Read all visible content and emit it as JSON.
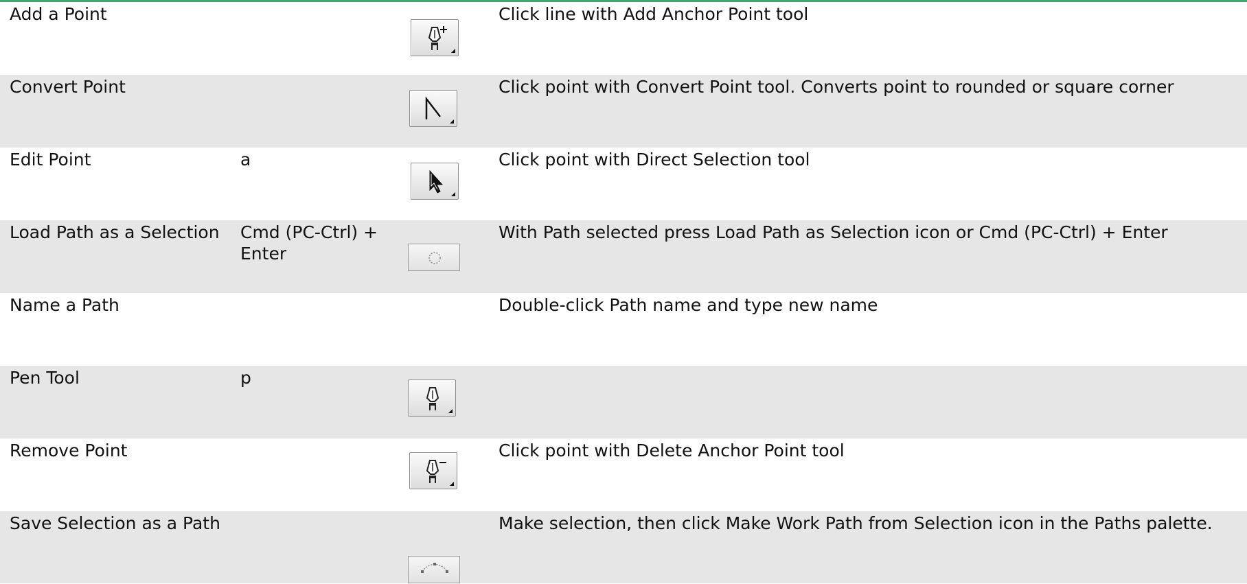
{
  "rows": [
    {
      "task": "Add a Point",
      "key": "",
      "icon": "add-anchor-point-icon",
      "description": "Click line with Add Anchor Point tool"
    },
    {
      "task": "Convert Point",
      "key": "",
      "icon": "convert-point-icon",
      "description": "Click point with Convert Point tool. Converts point to rounded or square corner"
    },
    {
      "task": "Edit Point",
      "key": "a",
      "icon": "direct-selection-icon",
      "description": "Click point with Direct Selection tool"
    },
    {
      "task": "Load Path as a Selection",
      "key": "Cmd (PC-Ctrl) + Enter",
      "icon": "load-path-as-selection-icon",
      "description": "With Path selected press Load Path as Selection icon or Cmd (PC-Ctrl) + Enter"
    },
    {
      "task": "Name a Path",
      "key": "",
      "icon": "",
      "description": "Double-click Path name and type new name"
    },
    {
      "task": "Pen Tool",
      "key": "p",
      "icon": "pen-tool-icon",
      "description": ""
    },
    {
      "task": "Remove Point",
      "key": "",
      "icon": "delete-anchor-point-icon",
      "description": "Click point with Delete Anchor Point tool"
    },
    {
      "task": "Save Selection as a Path",
      "key": "",
      "icon": "make-work-path-icon",
      "description": "Make selection, then click Make Work Path from Selection icon in the Paths palette."
    }
  ],
  "colors": {
    "accent_line": "#3aa86b",
    "row_shade": "#e6e6e6",
    "text": "#111111"
  }
}
